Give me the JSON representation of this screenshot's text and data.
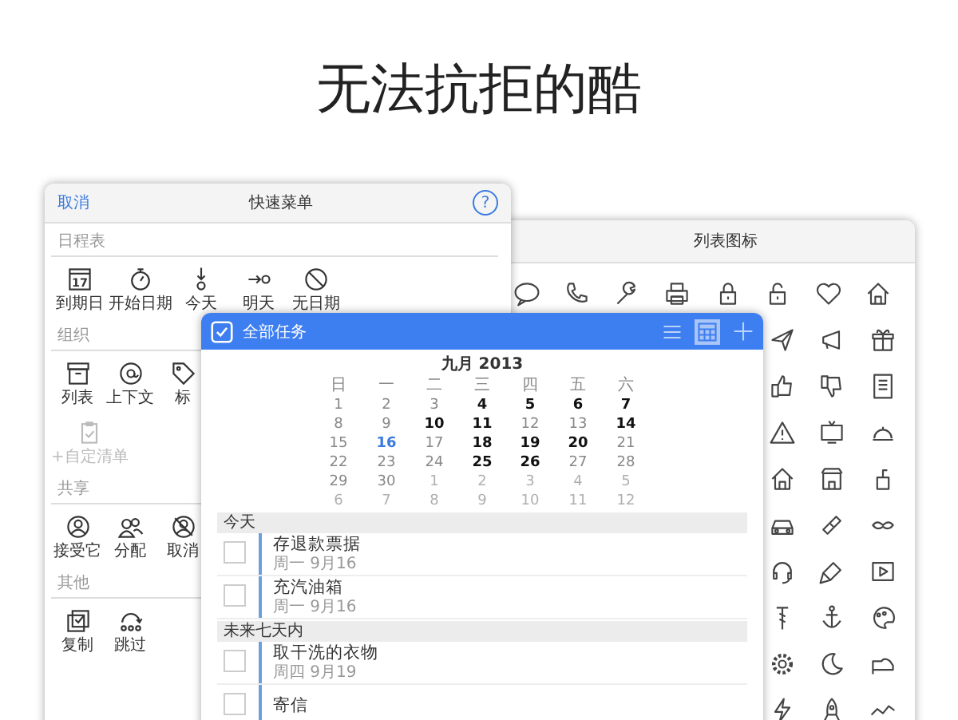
{
  "headline": "无法抗拒的酷",
  "quick_menu": {
    "cancel": "取消",
    "title": "快速菜单",
    "help": "?",
    "sections": [
      {
        "title": "日程表",
        "items": [
          {
            "label": "到期日",
            "icon_text": "17",
            "disabled": false
          },
          {
            "label": "开始日期",
            "disabled": false
          },
          {
            "label": "今天",
            "disabled": false
          },
          {
            "label": "明天",
            "disabled": false
          },
          {
            "label": "无日期",
            "disabled": false
          }
        ]
      },
      {
        "title": "组织",
        "items": [
          {
            "label": "列表",
            "disabled": false
          },
          {
            "label": "上下文",
            "disabled": false
          },
          {
            "label": "标",
            "disabled": false
          },
          {
            "label": "+自定清单",
            "disabled": true
          }
        ]
      },
      {
        "title": "共享",
        "items": [
          {
            "label": "接受它",
            "disabled": false
          },
          {
            "label": "分配",
            "disabled": false
          },
          {
            "label": "取消",
            "disabled": false
          }
        ]
      },
      {
        "title": "其他",
        "items": [
          {
            "label": "复制",
            "disabled": false
          },
          {
            "label": "跳过",
            "disabled": false
          }
        ]
      }
    ]
  },
  "list_icons": {
    "title": "列表图标"
  },
  "tasks_window": {
    "title": "全部任务",
    "view_buttons": [
      {
        "kind": "list",
        "selected": false
      },
      {
        "kind": "calendar",
        "selected": true
      }
    ],
    "calendar": {
      "month": "九月 2013",
      "weekdays": [
        "日",
        "一",
        "二",
        "三",
        "四",
        "五",
        "六"
      ],
      "days": [
        {
          "day": "1",
          "kind": "idle"
        },
        {
          "day": "2",
          "kind": "idle"
        },
        {
          "day": "3",
          "kind": "idle"
        },
        {
          "day": "4",
          "kind": "busy"
        },
        {
          "day": "5",
          "kind": "busy"
        },
        {
          "day": "6",
          "kind": "busy"
        },
        {
          "day": "7",
          "kind": "busy"
        },
        {
          "day": "8",
          "kind": "idle"
        },
        {
          "day": "9",
          "kind": "idle"
        },
        {
          "day": "10",
          "kind": "busy"
        },
        {
          "day": "11",
          "kind": "busy"
        },
        {
          "day": "12",
          "kind": "idle"
        },
        {
          "day": "13",
          "kind": "idle"
        },
        {
          "day": "14",
          "kind": "busy"
        },
        {
          "day": "15",
          "kind": "idle"
        },
        {
          "day": "16",
          "kind": "today"
        },
        {
          "day": "17",
          "kind": "idle"
        },
        {
          "day": "18",
          "kind": "busy"
        },
        {
          "day": "19",
          "kind": "busy"
        },
        {
          "day": "20",
          "kind": "busy"
        },
        {
          "day": "21",
          "kind": "idle"
        },
        {
          "day": "22",
          "kind": "idle"
        },
        {
          "day": "23",
          "kind": "idle"
        },
        {
          "day": "24",
          "kind": "idle"
        },
        {
          "day": "25",
          "kind": "busy"
        },
        {
          "day": "26",
          "kind": "busy"
        },
        {
          "day": "27",
          "kind": "idle"
        },
        {
          "day": "28",
          "kind": "idle"
        },
        {
          "day": "29",
          "kind": "idle"
        },
        {
          "day": "30",
          "kind": "idle"
        },
        {
          "day": "1",
          "kind": "other"
        },
        {
          "day": "2",
          "kind": "other"
        },
        {
          "day": "3",
          "kind": "other"
        },
        {
          "day": "4",
          "kind": "other"
        },
        {
          "day": "5",
          "kind": "other"
        },
        {
          "day": "6",
          "kind": "other"
        },
        {
          "day": "7",
          "kind": "other"
        },
        {
          "day": "8",
          "kind": "other"
        },
        {
          "day": "9",
          "kind": "other"
        },
        {
          "day": "10",
          "kind": "other"
        },
        {
          "day": "11",
          "kind": "other"
        },
        {
          "day": "12",
          "kind": "other"
        }
      ]
    },
    "sections": [
      {
        "title": "今天",
        "tasks": [
          {
            "title": "存退款票据",
            "date": "周一 9月16",
            "checked": false
          },
          {
            "title": "充汽油箱",
            "date": "周一 9月16",
            "checked": false
          }
        ]
      },
      {
        "title": "未来七天内",
        "tasks": [
          {
            "title": "取干洗的衣物",
            "date": "周四 9月19",
            "checked": false
          },
          {
            "title": "寄信",
            "checked": false
          }
        ]
      }
    ]
  }
}
